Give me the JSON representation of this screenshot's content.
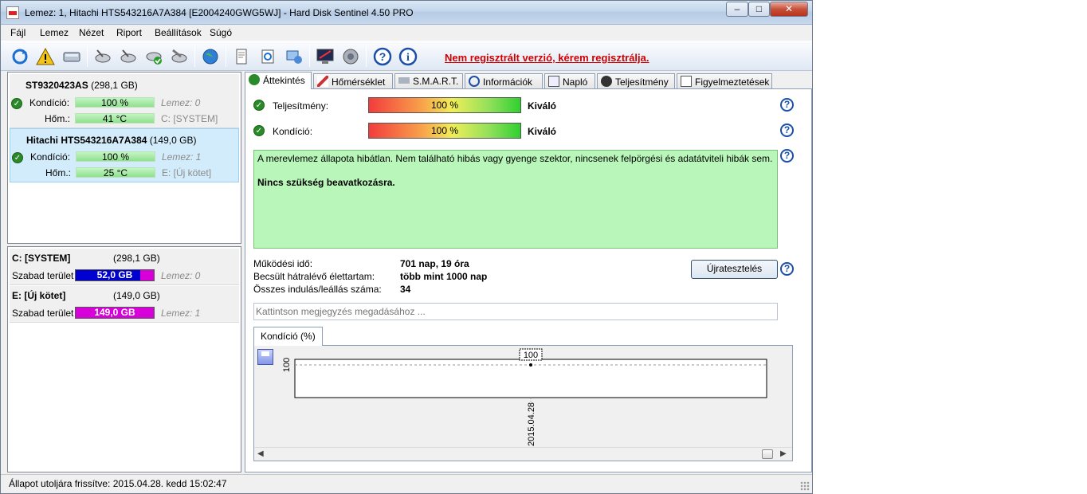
{
  "window": {
    "title": "Lemez: 1, Hitachi HTS543216A7A384 [E2004240GWG5WJ]  -  Hard Disk Sentinel 4.50 PRO",
    "minimize": "–",
    "maximize": "□",
    "close": "✕"
  },
  "menu": [
    {
      "label": "Fájl"
    },
    {
      "label": "Lemez"
    },
    {
      "label": "Nézet"
    },
    {
      "label": "Riport"
    },
    {
      "label": "Beállítások"
    },
    {
      "label": "Súgó"
    }
  ],
  "toolbar": {
    "register_link": "Nem regisztrált verzió, kérem regisztrálja.",
    "icons": [
      "refresh-icon",
      "warning-icon",
      "disk-icon",
      "disk-test-icon",
      "disk-test-icon",
      "disk-ok-icon",
      "disk-tool-icon",
      "globe-icon",
      "report-icon",
      "sync-icon",
      "send-icon",
      "monitor-icon",
      "speaker-icon",
      "help-icon",
      "info-icon"
    ]
  },
  "disks": [
    {
      "name": "ST9320423AS",
      "size": "(298,1 GB)",
      "condition_label": "Kondíció:",
      "condition_value": "100 %",
      "condition_note": "Lemez: 0",
      "temp_label": "Hőm.:",
      "temp_value": "41 °C",
      "temp_note": "C: [SYSTEM]"
    },
    {
      "name": "Hitachi HTS543216A7A384",
      "size": "(149,0 GB)",
      "condition_label": "Kondíció:",
      "condition_value": "100 %",
      "condition_note": "Lemez: 1",
      "temp_label": "Hőm.:",
      "temp_value": "25 °C",
      "temp_note": "E: [Új kötet]"
    }
  ],
  "volumes": [
    {
      "name": "C: [SYSTEM]",
      "size": "(298,1 GB)",
      "free_label": "Szabad terület",
      "free_value": "52,0 GB",
      "free_fraction": 0.83,
      "disk_note": "Lemez: 0"
    },
    {
      "name": "E: [Új kötet]",
      "size": "(149,0 GB)",
      "free_label": "Szabad terület",
      "free_value": "149,0 GB",
      "free_fraction": 0.0,
      "disk_note": "Lemez: 1"
    }
  ],
  "tabs": [
    {
      "label": "Áttekintés"
    },
    {
      "label": "Hőmérséklet"
    },
    {
      "label": "S.M.A.R.T."
    },
    {
      "label": "Információk"
    },
    {
      "label": "Napló"
    },
    {
      "label": "Teljesítmény"
    },
    {
      "label": "Figyelmeztetések"
    }
  ],
  "overview": {
    "performance_label": "Teljesítmény:",
    "performance_value": "100 %",
    "performance_rating": "Kiváló",
    "condition_label": "Kondíció:",
    "condition_value": "100 %",
    "condition_rating": "Kiváló",
    "summary_text": "A merevlemez állapota hibátlan. Nem található hibás vagy gyenge szektor, nincsenek felpörgési és adatátviteli hibák sem.",
    "summary_bold": "Nincs szükség beavatkozásra.",
    "uptime_label": "Működési idő:",
    "uptime_value": "701 nap, 19 óra",
    "remaining_label": "Becsült hátralévő élettartam:",
    "remaining_value": "több mint 1000 nap",
    "startstop_label": "Összes indulás/leállás száma:",
    "startstop_value": "34",
    "retest_button": "Újratesztelés",
    "note_placeholder": "Kattintson megjegyzés megadásához ...",
    "help": "?"
  },
  "chart_tab": "Kondíció  (%)",
  "chart_data": {
    "type": "line",
    "x": [
      "2015.04.28"
    ],
    "values": [
      100
    ],
    "y_tick_label": "100",
    "point_label": "100",
    "ylim": [
      0,
      100
    ],
    "grid": true
  },
  "status": {
    "text": "Állapot utoljára frissítve: 2015.04.28. kedd 15:02:47"
  }
}
